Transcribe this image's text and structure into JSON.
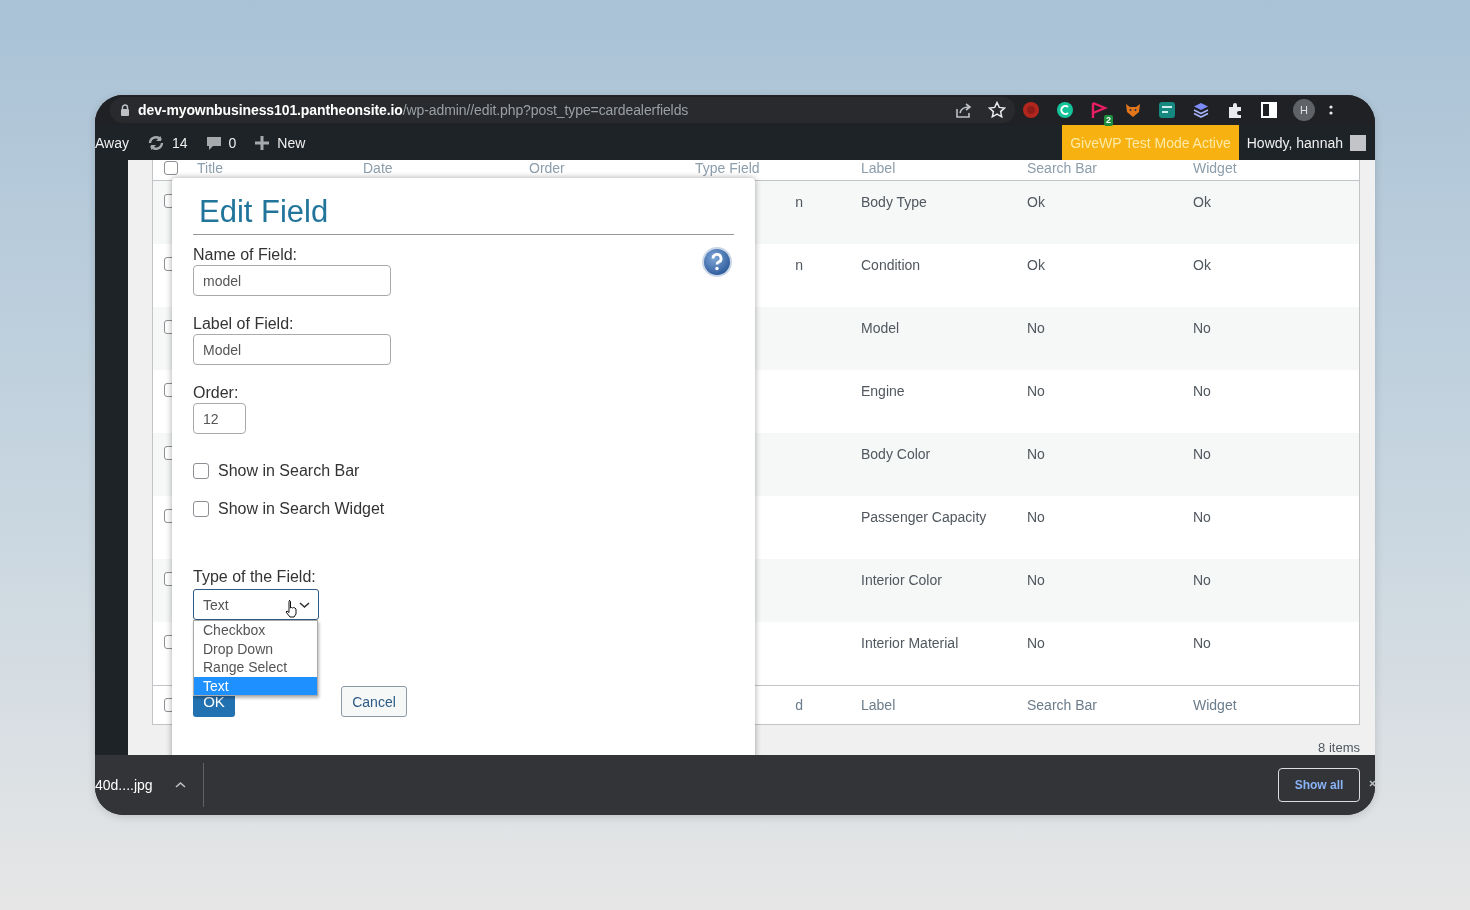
{
  "browser": {
    "url_host": "dev-myownbusiness101.pantheonsite.io",
    "url_path": "/wp-admin//edit.php?post_type=cardealerfields",
    "extension_badge": "2",
    "profile_initial": "H"
  },
  "admin_bar": {
    "items": [
      {
        "kind": "text",
        "label": "Away"
      },
      {
        "kind": "updates",
        "label": "14"
      },
      {
        "kind": "comments",
        "label": "0"
      },
      {
        "kind": "new",
        "label": "New"
      }
    ],
    "notice": "GiveWP Test Mode Active",
    "greeting": "Howdy, hannah"
  },
  "table": {
    "select_all_checked": false,
    "columns": [
      "Title",
      "Date",
      "Order",
      "Type Field",
      "Label",
      "Search Bar",
      "Widget"
    ],
    "rows": [
      {
        "checked": false,
        "type_field": "n",
        "label": "Body Type",
        "search_bar": "Ok",
        "widget": "Ok"
      },
      {
        "checked": false,
        "type_field": "n",
        "label": "Condition",
        "search_bar": "Ok",
        "widget": "Ok"
      },
      {
        "checked": false,
        "label": "Model",
        "search_bar": "No",
        "widget": "No"
      },
      {
        "checked": false,
        "label": "Engine",
        "search_bar": "No",
        "widget": "No"
      },
      {
        "checked": false,
        "label": "Body Color",
        "search_bar": "No",
        "widget": "No"
      },
      {
        "checked": false,
        "label": "Passenger Capacity",
        "search_bar": "No",
        "widget": "No"
      },
      {
        "checked": false,
        "label": "Interior Color",
        "search_bar": "No",
        "widget": "No"
      },
      {
        "checked": false,
        "label": "Interior Material",
        "search_bar": "No",
        "widget": "No"
      }
    ],
    "footer": {
      "checked": false,
      "type_field": "d",
      "label": "Label",
      "search_bar": "Search Bar",
      "widget": "Widget"
    },
    "count": "8 items"
  },
  "dialog": {
    "title": "Edit Field",
    "fields": [
      {
        "label": "Name of Field:",
        "value": "model",
        "kind": "wide"
      },
      {
        "label": "Label of Field:",
        "value": "Model",
        "kind": "wide"
      },
      {
        "label": "Order:",
        "value": "12",
        "kind": "short"
      }
    ],
    "checkboxes": [
      {
        "label": "Show in Search Bar",
        "checked": false
      },
      {
        "label": "Show in Search Widget",
        "checked": false
      }
    ],
    "type_label": "Type of the Field:",
    "type_value": "Text",
    "options": [
      {
        "label": "Checkbox",
        "selected": false
      },
      {
        "label": "Drop Down",
        "selected": false
      },
      {
        "label": "Range Select",
        "selected": false
      },
      {
        "label": "Text",
        "selected": true
      }
    ],
    "ok": "OK",
    "cancel": "Cancel"
  },
  "download_bar": {
    "file": "40d....jpg",
    "button": "Show all"
  }
}
